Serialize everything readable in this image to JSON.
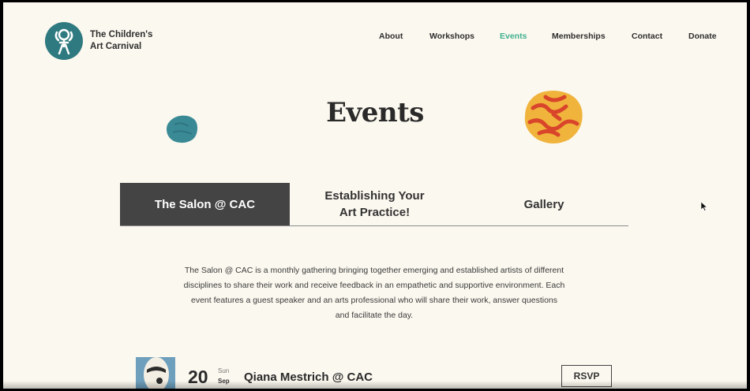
{
  "site": {
    "name_line1": "The Children's",
    "name_line2": "Art Carnival"
  },
  "nav": {
    "items": [
      {
        "label": "About",
        "active": false
      },
      {
        "label": "Workshops",
        "active": false
      },
      {
        "label": "Events",
        "active": true
      },
      {
        "label": "Memberships",
        "active": false
      },
      {
        "label": "Contact",
        "active": false
      },
      {
        "label": "Donate",
        "active": false
      }
    ]
  },
  "page": {
    "title": "Events"
  },
  "tabs": [
    {
      "label": "The Salon @ CAC",
      "active": true
    },
    {
      "label_line1": "Establishing Your",
      "label_line2": "Art Practice!",
      "active": false
    },
    {
      "label": "Gallery",
      "active": false
    }
  ],
  "description": "The Salon @ CAC is a monthly gathering bringing together emerging and established artists of different disciplines to share their work and receive feedback in an empathetic and supportive environment. Each event features a guest speaker and an arts professional who will share their work, answer questions and facilitate the day.",
  "events": [
    {
      "day": "20",
      "weekday": "Sun",
      "month": "Sep",
      "title": "Qiana Mestrich @ CAC",
      "rsvp_label": "RSVP"
    }
  ],
  "colors": {
    "background": "#fbf8ef",
    "accent_green": "#3fb08f",
    "logo_teal": "#2f7a80",
    "active_tab": "#444444",
    "blob_teal": "#3a8a95",
    "blob_orange": "#f0b43c",
    "blob_red": "#d9452b"
  }
}
